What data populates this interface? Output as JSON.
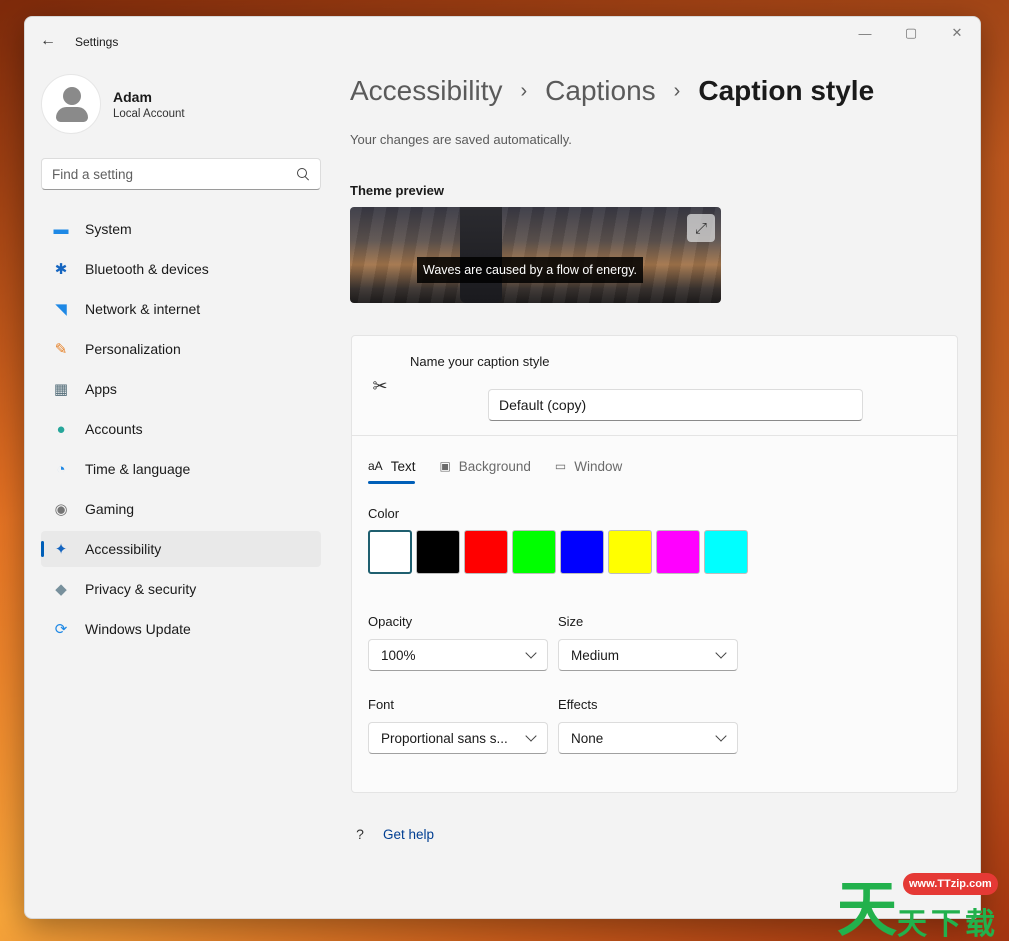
{
  "window": {
    "title": "Settings",
    "back_glyph": "←",
    "controls": {
      "minimize": "—",
      "maximize": "▢",
      "close": "✕"
    }
  },
  "profile": {
    "name": "Adam",
    "subtitle": "Local Account"
  },
  "search": {
    "placeholder": "Find a setting"
  },
  "sidebar": {
    "items": [
      {
        "label": "System",
        "icon": "system-icon",
        "glyph": "▬",
        "color": "#1e88e5"
      },
      {
        "label": "Bluetooth & devices",
        "icon": "bluetooth-icon",
        "glyph": "✱",
        "color": "#1565c0"
      },
      {
        "label": "Network & internet",
        "icon": "wifi-icon",
        "glyph": "◥",
        "color": "#1e88e5"
      },
      {
        "label": "Personalization",
        "icon": "brush-icon",
        "glyph": "✎",
        "color": "#e67e22"
      },
      {
        "label": "Apps",
        "icon": "apps-icon",
        "glyph": "▦",
        "color": "#546e7a"
      },
      {
        "label": "Accounts",
        "icon": "accounts-icon",
        "glyph": "●",
        "color": "#26a69a"
      },
      {
        "label": "Time & language",
        "icon": "clock-globe-icon",
        "glyph": "◔",
        "color": "#1e88e5"
      },
      {
        "label": "Gaming",
        "icon": "gamepad-icon",
        "glyph": "◉",
        "color": "#757575"
      },
      {
        "label": "Accessibility",
        "icon": "accessibility-icon",
        "glyph": "✦",
        "color": "#1565c0",
        "active": true
      },
      {
        "label": "Privacy & security",
        "icon": "shield-icon",
        "glyph": "◆",
        "color": "#78909c"
      },
      {
        "label": "Windows Update",
        "icon": "update-icon",
        "glyph": "⟳",
        "color": "#1e88e5"
      }
    ]
  },
  "breadcrumb": {
    "items": [
      "Accessibility",
      "Captions",
      "Caption style"
    ],
    "separator": "›"
  },
  "autosave_text": "Your changes are saved automatically.",
  "theme_preview": {
    "label": "Theme preview",
    "caption": "Waves are caused by a flow of energy.",
    "expand_glyph": "⤢"
  },
  "caption_style": {
    "name_label": "Name your caption style",
    "name_value": "Default (copy)",
    "name_icon_glyph": "✂"
  },
  "tabs": [
    {
      "label": "Text",
      "glyph": "aA",
      "active": true
    },
    {
      "label": "Background",
      "glyph": "▣"
    },
    {
      "label": "Window",
      "glyph": "▭"
    }
  ],
  "color": {
    "label": "Color",
    "swatches": [
      "#ffffff",
      "#000000",
      "#ff0000",
      "#00ff00",
      "#0000ff",
      "#ffff00",
      "#ff00ff",
      "#00ffff"
    ],
    "selected_index": 0
  },
  "fields": {
    "opacity": {
      "label": "Opacity",
      "value": "100%"
    },
    "size": {
      "label": "Size",
      "value": "Medium"
    },
    "font": {
      "label": "Font",
      "value": "Proportional sans s..."
    },
    "effects": {
      "label": "Effects",
      "value": "None"
    }
  },
  "help": {
    "label": "Get help",
    "glyph": "?"
  },
  "watermark": {
    "chars": [
      "天",
      "天",
      "下",
      "载"
    ],
    "url": "www.TTzip.com"
  }
}
